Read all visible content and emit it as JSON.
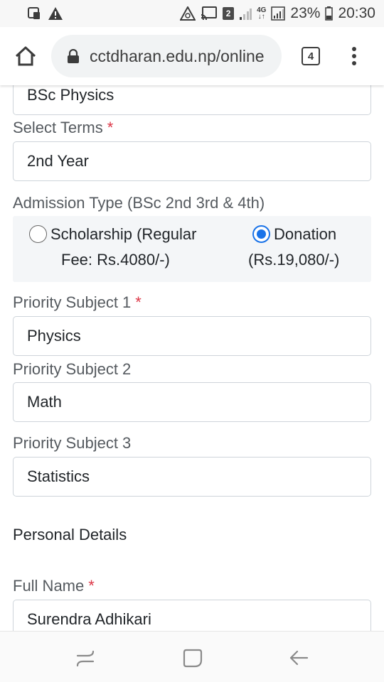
{
  "status_bar": {
    "battery": "23%",
    "time": "20:30",
    "badge": "2",
    "network": "4G"
  },
  "browser": {
    "url": "cctdharan.edu.np/online",
    "tab_count": "4"
  },
  "form": {
    "program_value": "BSc Physics",
    "terms_label": "Select Terms",
    "terms_value": "2nd Year",
    "admission_label": "Admission Type (BSc 2nd 3rd & 4th)",
    "admission_options": [
      {
        "line1": "Scholarship (Regular",
        "line2": "Fee: Rs.4080/-)",
        "checked": false
      },
      {
        "line1": "Donation",
        "line2": "(Rs.19,080/-)",
        "checked": true
      }
    ],
    "priority1_label": "Priority Subject 1",
    "priority1_value": "Physics",
    "priority2_label": "Priority Subject 2",
    "priority2_value": "Math",
    "priority3_label": "Priority Subject 3",
    "priority3_value": "Statistics",
    "personal_heading": "Personal Details",
    "fullname_label": "Full Name",
    "fullname_value": "Surendra Adhikari",
    "required_mark": "*"
  },
  "colors": {
    "accent": "#1a73e8",
    "required": "#dc3545",
    "border": "#ced4da"
  }
}
